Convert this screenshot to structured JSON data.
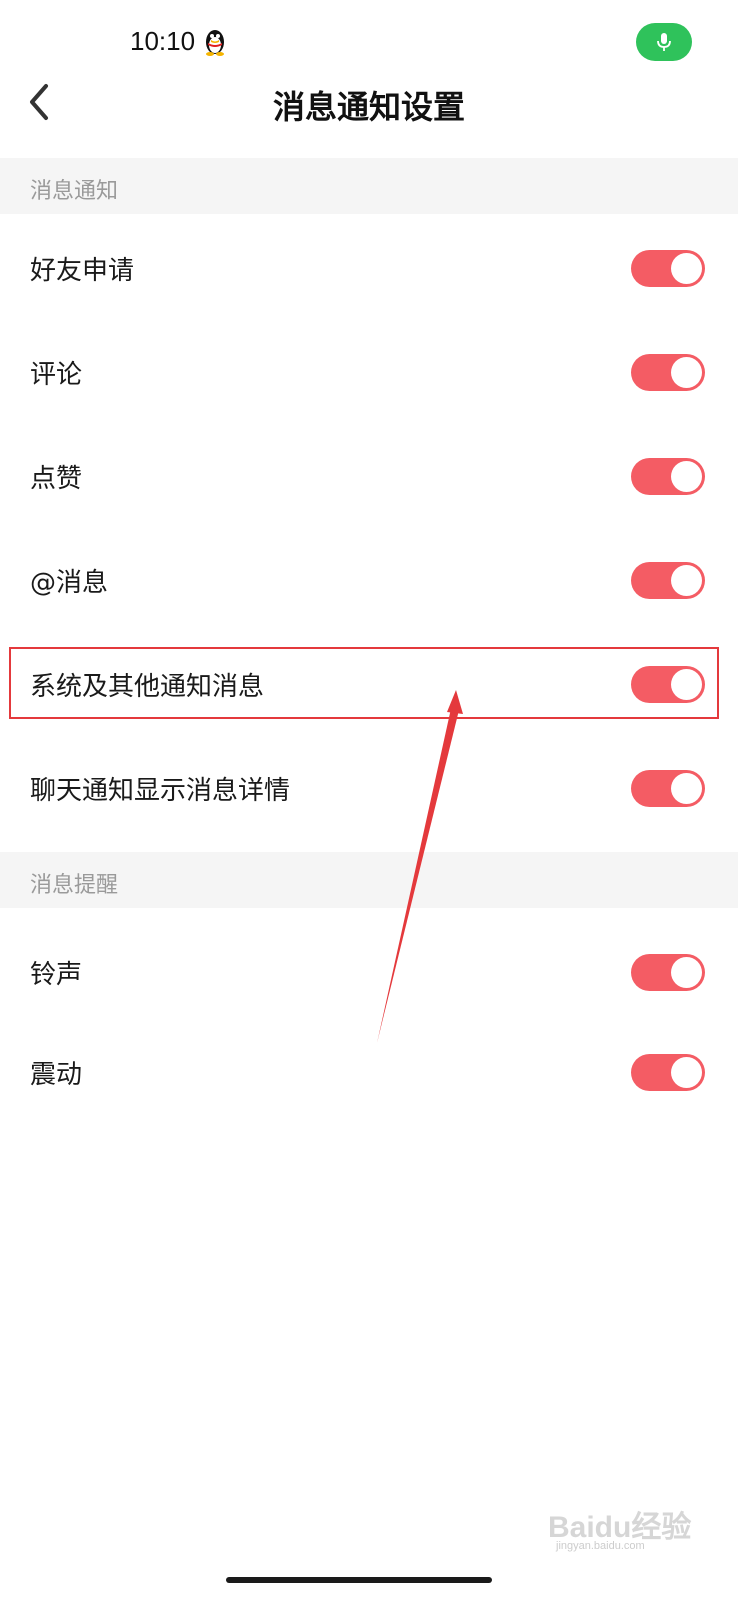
{
  "status_bar": {
    "time": "10:10",
    "app_icon": "qq-penguin-icon",
    "mic_indicator_color": "#2fc25b"
  },
  "nav": {
    "title": "消息通知设置",
    "back_icon": "chevron-left-icon"
  },
  "sections": [
    {
      "header": "消息通知",
      "items": [
        {
          "label": "好友申请",
          "enabled": true
        },
        {
          "label": "评论",
          "enabled": true
        },
        {
          "label": "点赞",
          "enabled": true
        },
        {
          "label": "@消息",
          "enabled": true
        },
        {
          "label": "系统及其他通知消息",
          "enabled": true,
          "highlighted": true
        },
        {
          "label": "聊天通知显示消息详情",
          "enabled": true
        }
      ]
    },
    {
      "header": "消息提醒",
      "items": [
        {
          "label": "铃声",
          "enabled": true
        },
        {
          "label": "震动",
          "enabled": true
        }
      ]
    }
  ],
  "colors": {
    "toggle_on": "#f45c64",
    "annotation": "#e4393c",
    "section_bg": "#f5f5f5"
  },
  "watermark": {
    "text": "Baidu经验",
    "sub": "jingyan.baidu.com"
  }
}
